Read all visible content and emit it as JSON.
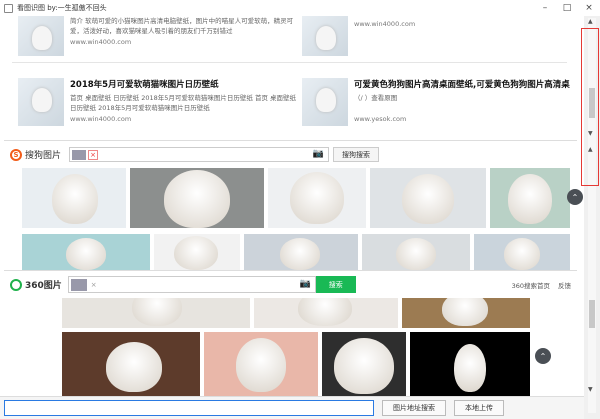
{
  "window": {
    "title": "看图识图 by:一生孤傲不回头",
    "minimize": "–",
    "maximize": "□",
    "close": "×"
  },
  "results": [
    {
      "title": "",
      "desc": "简介 软萌可爱的小猫咪图片高清电脑壁纸，图片中的喵星人可爱软萌，精灵可爱，活泼好动，喜欢猫咪星人吸引着的朋友们千万别错过",
      "source": "www.win4000.com"
    },
    {
      "title": "",
      "desc": "",
      "source": "www.win4000.com"
    },
    {
      "title": "2018年5月可爱软萌猫咪图片日历壁纸",
      "desc": "首页 桌面壁纸 日历壁纸 2018年5月可爱软萌猫咪图片日历壁纸 首页 桌面壁纸 日历壁纸 2018年5月可爱软萌猫咪图片日历壁纸",
      "source": "www.win4000.com"
    },
    {
      "title": "可爱黄色狗狗图片高清桌面壁纸,可爱黄色狗狗图片高清桌",
      "desc": "（/ ）查看原图",
      "source": "www.yesok.com"
    }
  ],
  "sogou": {
    "logo_text": "搜狗图片",
    "chip_close": "×",
    "camera_icon": "📷",
    "button": "搜狗搜索"
  },
  "s360": {
    "logo_text": "360图片",
    "chip_close": "×",
    "camera_icon": "📷",
    "button": "搜索",
    "links": [
      "360搜索首页",
      "反馈"
    ]
  },
  "up_arrow": "⌃",
  "bottom": {
    "url_placeholder": "",
    "btn_url_search": "图片地址搜索",
    "btn_upload": "本地上传"
  },
  "scroll": {
    "up": "▲",
    "down": "▼"
  },
  "colors": {
    "highlight_box": "#e53935",
    "sogou_accent": "#f25c19",
    "s360_accent": "#19b955",
    "url_input_border": "#2a7ae2"
  }
}
